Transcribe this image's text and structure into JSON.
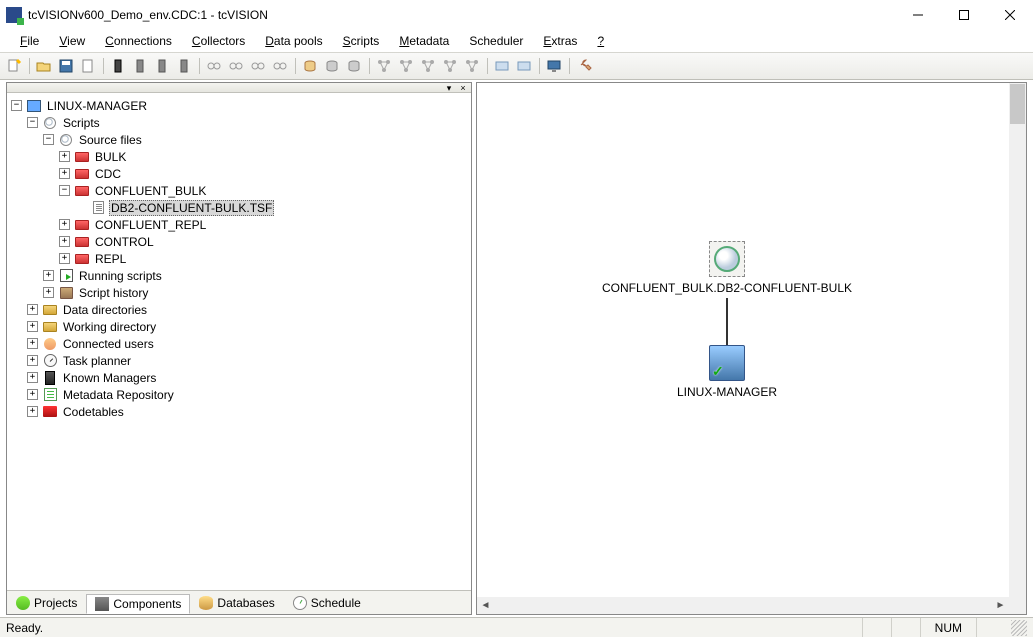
{
  "window": {
    "title": "tcVISIONv600_Demo_env.CDC:1 - tcVISION"
  },
  "menu": {
    "items": [
      {
        "accel": "F",
        "rest": "ile"
      },
      {
        "accel": "V",
        "rest": "iew"
      },
      {
        "accel": "C",
        "rest": "onnections"
      },
      {
        "accel": "C",
        "rest": "ollectors"
      },
      {
        "accel": "D",
        "rest": "ata pools"
      },
      {
        "accel": "S",
        "rest": "cripts"
      },
      {
        "accel": "M",
        "rest": "etadata"
      },
      {
        "accel": "",
        "rest": "Scheduler"
      },
      {
        "accel": "E",
        "rest": "xtras"
      },
      {
        "accel": "?",
        "rest": ""
      }
    ]
  },
  "tree": {
    "root": "LINUX-MANAGER",
    "scripts": "Scripts",
    "source_files": "Source files",
    "bulk": "BULK",
    "cdc": "CDC",
    "confluent_bulk": "CONFLUENT_BULK",
    "selected_file": "DB2-CONFLUENT-BULK.TSF",
    "confluent_repl": "CONFLUENT_REPL",
    "control": "CONTROL",
    "repl": "REPL",
    "running_scripts": "Running scripts",
    "script_history": "Script history",
    "data_directories": "Data directories",
    "working_directory": "Working directory",
    "connected_users": "Connected users",
    "task_planner": "Task planner",
    "known_managers": "Known Managers",
    "metadata_repository": "Metadata Repository",
    "codetables": "Codetables"
  },
  "bottom_tabs": {
    "projects": "Projects",
    "components": "Components",
    "databases": "Databases",
    "schedule": "Schedule"
  },
  "diagram": {
    "node1": "CONFLUENT_BULK.DB2-CONFLUENT-BULK",
    "node2": "LINUX-MANAGER"
  },
  "status": {
    "ready": "Ready.",
    "num": "NUM"
  }
}
